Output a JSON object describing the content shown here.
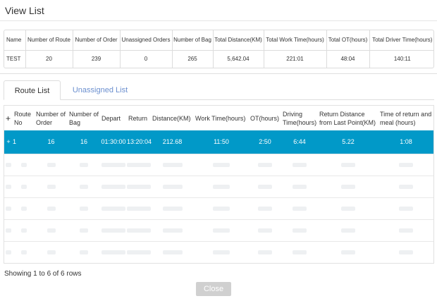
{
  "window": {
    "title": "View List"
  },
  "summary": {
    "headers": [
      "Name",
      "Number of Route",
      "Number of Order",
      "Unassigned Orders",
      "Number of Bag",
      "Total Distance(KM)",
      "Total Work Time(hours)",
      "Total OT(hours)",
      "Total Driver Time(hours)"
    ],
    "row": [
      "TEST",
      "20",
      "239",
      "0",
      "265",
      "5,642.04",
      "221:01",
      "48:04",
      "140:11"
    ]
  },
  "tabs": [
    {
      "label": "Route List",
      "active": true
    },
    {
      "label": "Unassigned List",
      "active": false
    }
  ],
  "routes": {
    "headers": [
      "+",
      "Route No",
      "Number of Order",
      "Number of Bag",
      "Depart",
      "Return",
      "Distance(KM)",
      "Work Time(hours)",
      "OT(hours)",
      "Driving Time(hours)",
      "Return Distance from Last Point(KM)",
      "Time of return and meal (hours)"
    ],
    "rows": [
      {
        "expand": "+",
        "route_no": "1",
        "orders": "16",
        "bags": "16",
        "depart": "01:30:00",
        "return": "13:20:04",
        "distance": "212.68",
        "work_time": "11:50",
        "ot": "2:50",
        "driving": "6:44",
        "return_distance": "5.22",
        "meal": "1:08"
      }
    ],
    "placeholder_rows": 5
  },
  "footer": {
    "status": "Showing 1 to 6 of 6 rows",
    "close_label": "Close"
  },
  "colors": {
    "highlight": "#0199c8",
    "tab_inactive": "#6b8fcf",
    "close_button": "#d0d0d0"
  }
}
